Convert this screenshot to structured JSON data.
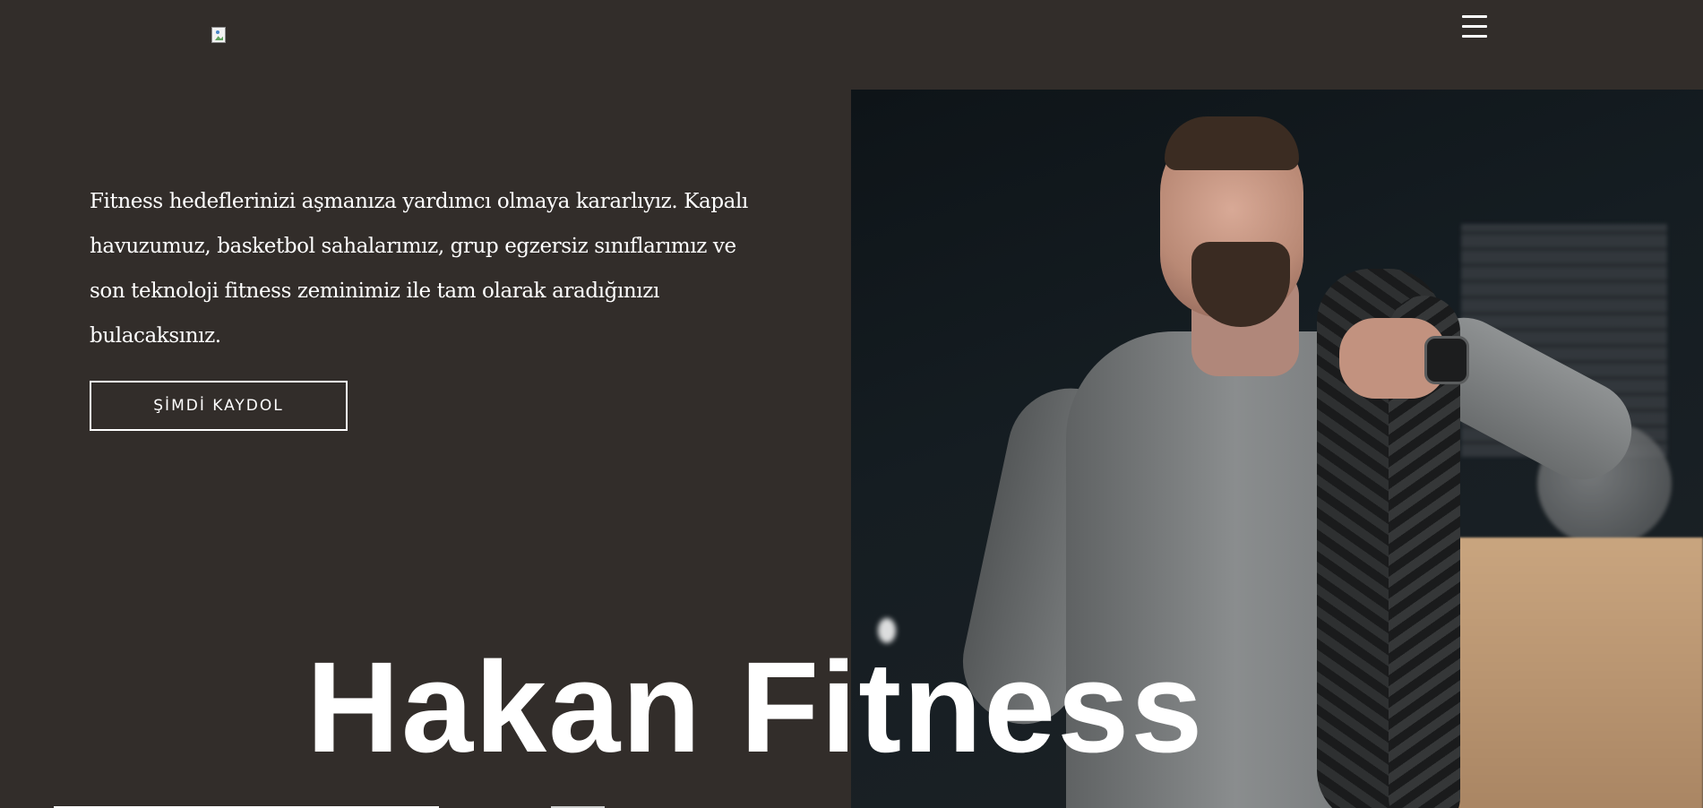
{
  "header": {
    "logo_alt": "",
    "menu_icon": "hamburger-menu-icon"
  },
  "hero": {
    "intro_text": "Fitness hedeflerinizi aşmanıza yardımcı olmaya kararlıyız. Kapalı havuzumuz, basketbol sahalarımız, grup egzersiz sınıflarımız ve son teknoloji fitness zeminimiz ile tam olarak aradığınızı bulacaksınız.",
    "cta_label": "ŞİMDİ KAYDOL",
    "title": "Hakan Fitness"
  },
  "colors": {
    "background": "#322d2a",
    "text": "#ffffff"
  }
}
